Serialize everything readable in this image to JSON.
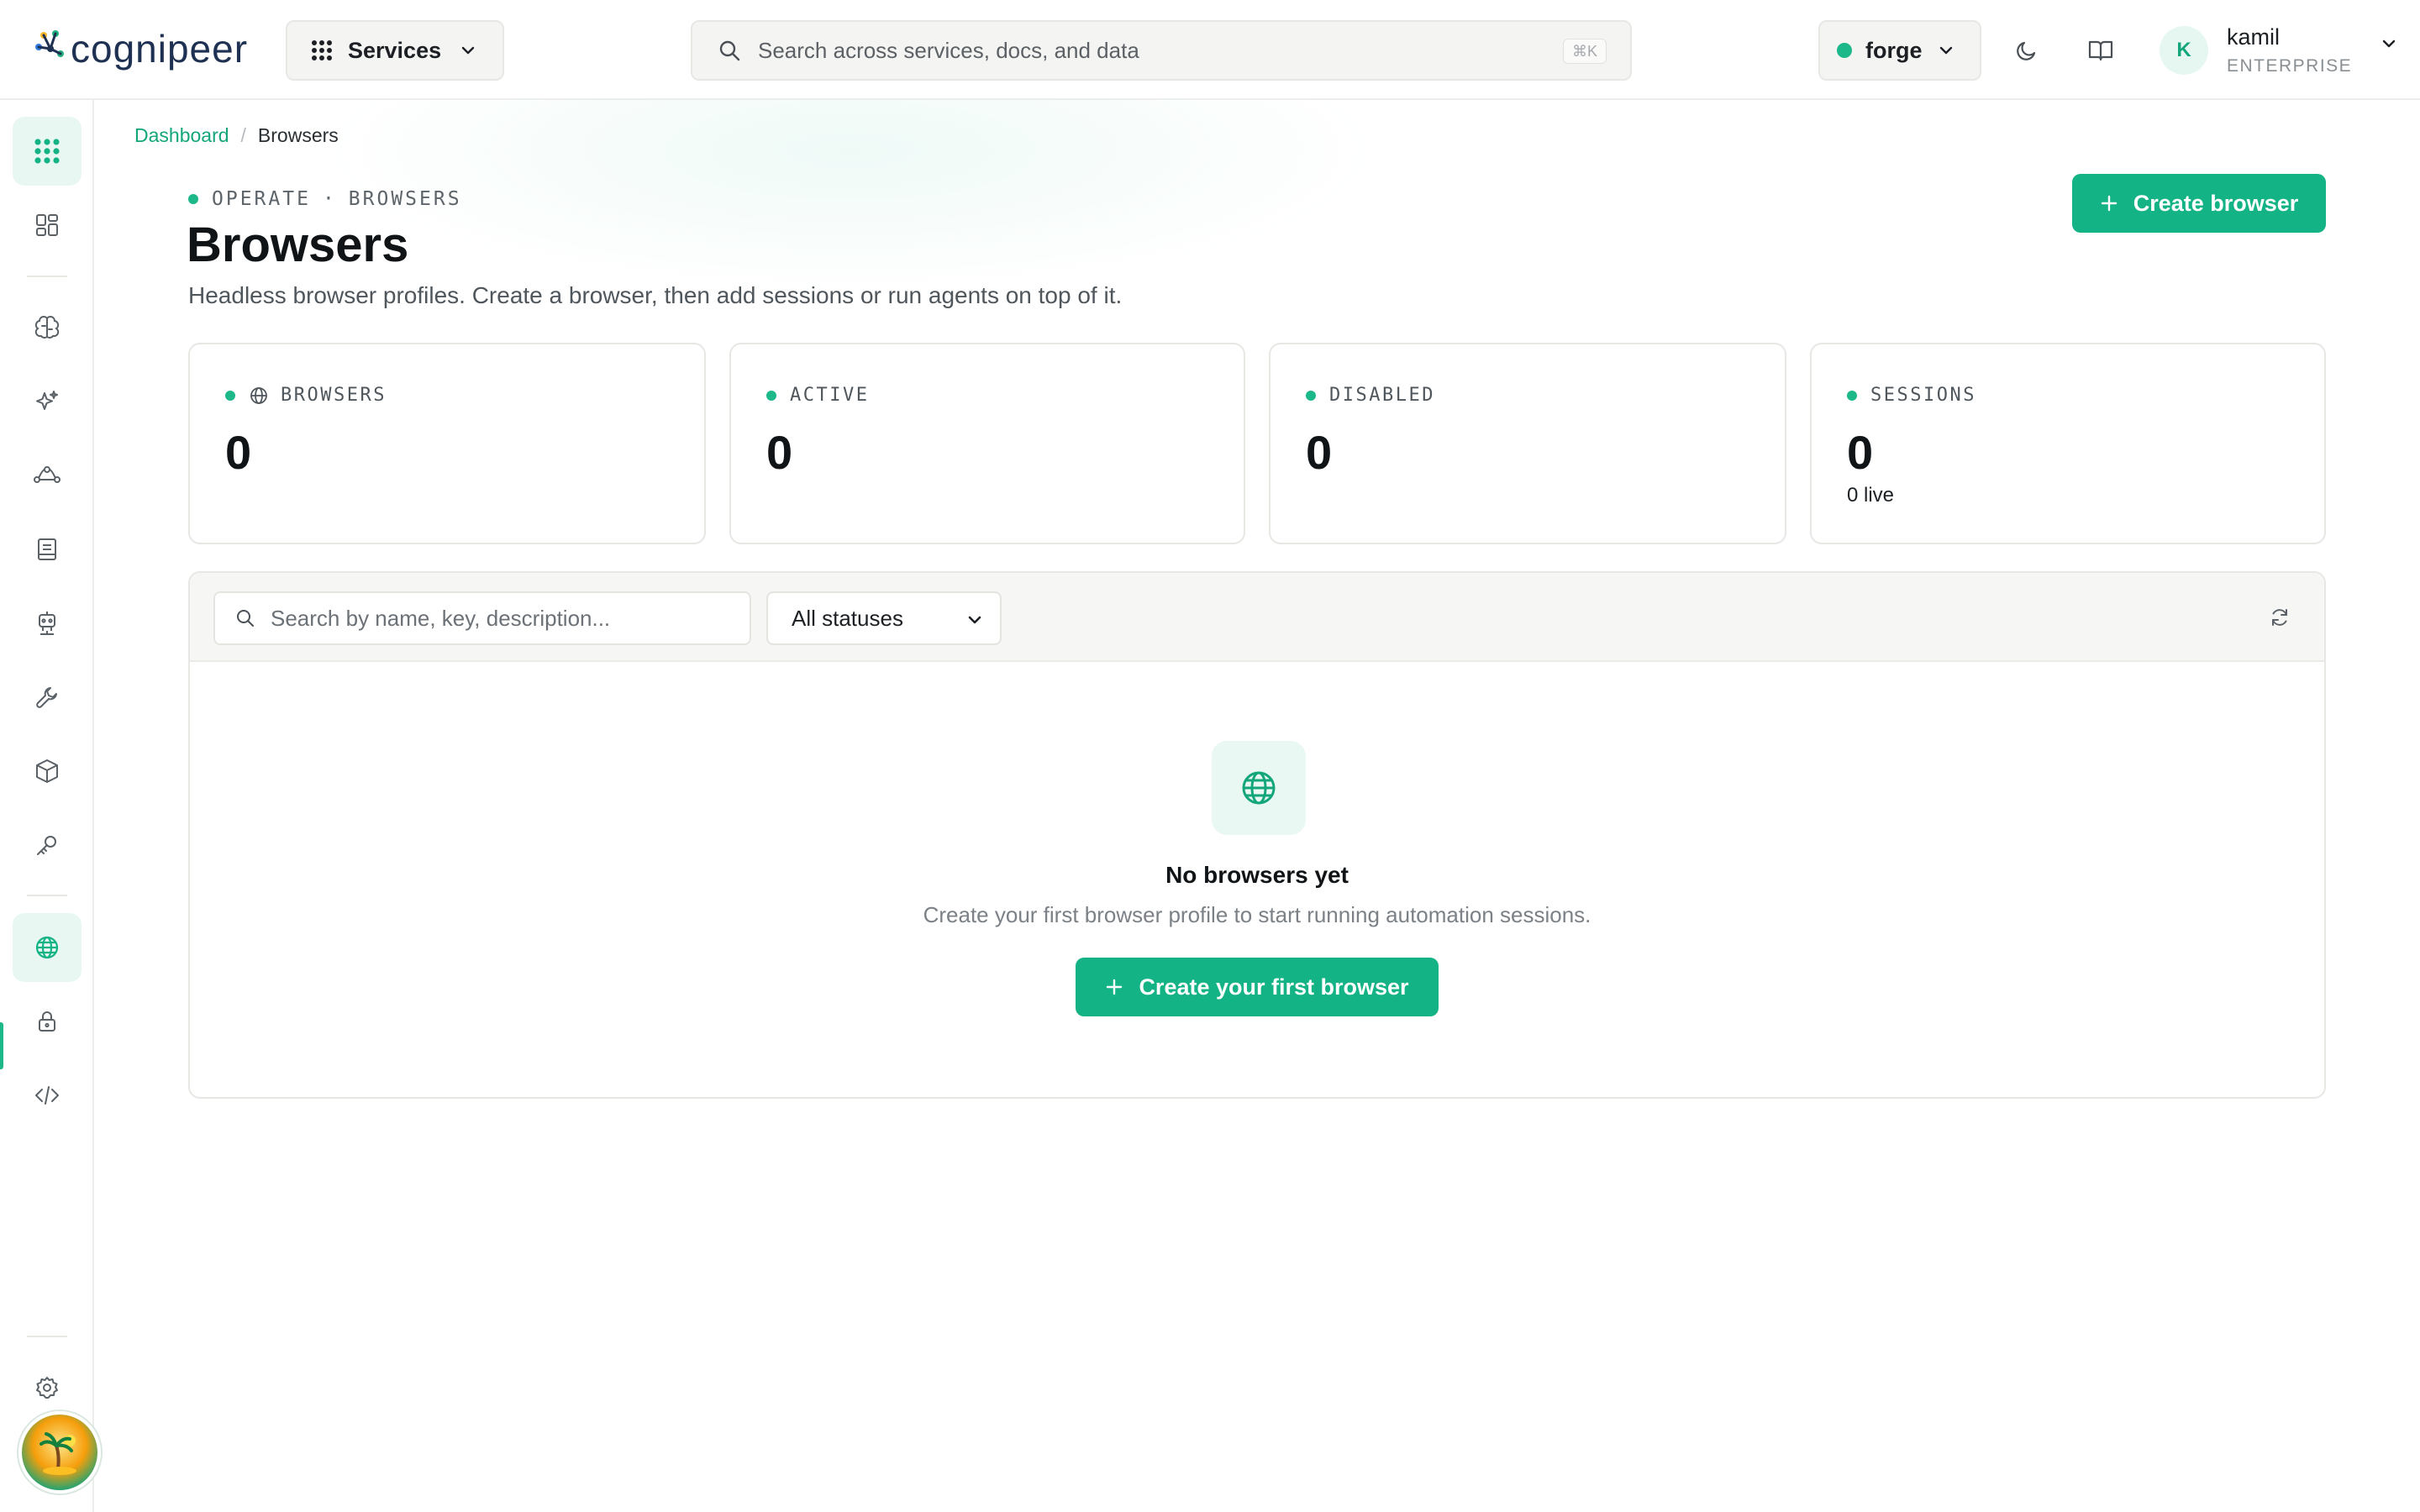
{
  "app": {
    "logo_text": "cognipeer"
  },
  "header": {
    "services_label": "Services",
    "search_placeholder": "Search across services, docs, and data",
    "search_shortcut": "⌘K",
    "workspace": {
      "name": "forge",
      "status_color": "#1cb88a"
    },
    "user": {
      "initial": "K",
      "name": "kamil",
      "plan": "ENTERPRISE"
    }
  },
  "sidebar": {
    "items": [
      {
        "id": "apps",
        "icon": "grid-dots-icon",
        "active": true
      },
      {
        "id": "dashboard",
        "icon": "dashboard-icon"
      },
      {
        "id": "models",
        "icon": "brain-icon"
      },
      {
        "id": "ai",
        "icon": "sparkles-icon"
      },
      {
        "id": "flows",
        "icon": "flow-icon"
      },
      {
        "id": "docs",
        "icon": "notebook-icon"
      },
      {
        "id": "agents",
        "icon": "robot-icon"
      },
      {
        "id": "tools",
        "icon": "wrench-icon"
      },
      {
        "id": "packages",
        "icon": "box-icon"
      },
      {
        "id": "keys",
        "icon": "key-icon"
      },
      {
        "id": "browsers",
        "icon": "globe-icon",
        "active": true
      },
      {
        "id": "vault",
        "icon": "lock-icon"
      },
      {
        "id": "code",
        "icon": "code-icon"
      },
      {
        "id": "settings",
        "icon": "gear-icon"
      }
    ]
  },
  "breadcrumb": {
    "parent": "Dashboard",
    "separator": "/",
    "current": "Browsers"
  },
  "page": {
    "eyebrow_section": "OPERATE",
    "eyebrow_separator": "·",
    "eyebrow_page": "BROWSERS",
    "title": "Browsers",
    "subtitle": "Headless browser profiles. Create a browser, then add sessions or run agents on top of it.",
    "create_label": "Create browser"
  },
  "stats": [
    {
      "label": "BROWSERS",
      "value": "0",
      "icon": "globe-icon"
    },
    {
      "label": "ACTIVE",
      "value": "0"
    },
    {
      "label": "DISABLED",
      "value": "0"
    },
    {
      "label": "SESSIONS",
      "value": "0",
      "sub": "0 live"
    }
  ],
  "filters": {
    "search_placeholder": "Search by name, key, description...",
    "status_selected": "All statuses"
  },
  "empty_state": {
    "title": "No browsers yet",
    "text": "Create your first browser profile to start running automation sessions.",
    "button_label": "Create your first browser"
  },
  "colors": {
    "accent": "#14b386",
    "accent_soft": "#e8f7f1",
    "text": "#111417"
  }
}
